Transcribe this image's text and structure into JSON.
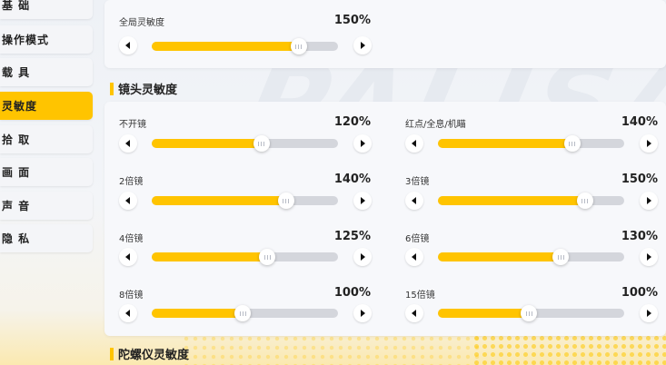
{
  "sidebar": {
    "items": [
      {
        "label": "基 础"
      },
      {
        "label": "操作模式"
      },
      {
        "label": "载 具"
      },
      {
        "label": "灵敏度"
      },
      {
        "label": "拾 取"
      },
      {
        "label": "画 面"
      },
      {
        "label": "声 音"
      },
      {
        "label": "隐 私"
      }
    ],
    "active_index": 3
  },
  "global": {
    "label": "全局灵敏度",
    "value": "150%",
    "level": 0.79
  },
  "scope_section": {
    "title": "镜头灵敏度",
    "sliders": [
      {
        "label": "不开镜",
        "value": "120%",
        "level": 0.59
      },
      {
        "label": "红点/全息/机瞄",
        "value": "140%",
        "level": 0.72
      },
      {
        "label": "2倍镜",
        "value": "140%",
        "level": 0.72
      },
      {
        "label": "3倍镜",
        "value": "150%",
        "level": 0.79
      },
      {
        "label": "4倍镜",
        "value": "125%",
        "level": 0.62
      },
      {
        "label": "6倍镜",
        "value": "130%",
        "level": 0.66
      },
      {
        "label": "8倍镜",
        "value": "100%",
        "level": 0.49
      },
      {
        "label": "15倍镜",
        "value": "100%",
        "level": 0.49
      }
    ]
  },
  "gyro_section": {
    "title": "陀螺仪灵敏度"
  },
  "colors": {
    "accent": "#ffc400",
    "track": "#d4d6dc"
  },
  "icons": {
    "decrease": "chevron-left-icon",
    "increase": "chevron-right-icon"
  }
}
